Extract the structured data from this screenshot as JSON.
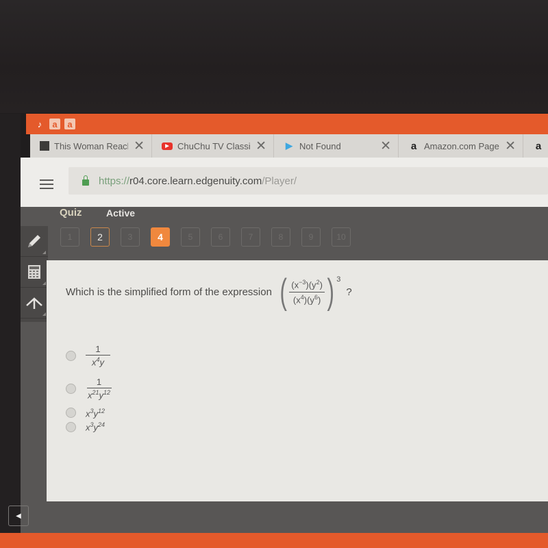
{
  "bookmarks": [
    {
      "icon": "tiktok-icon",
      "glyph": "♪"
    },
    {
      "icon": "amazon-icon",
      "glyph": "a"
    },
    {
      "icon": "amazon-icon",
      "glyph": "a"
    }
  ],
  "tabs": [
    {
      "title": "This Woman Reach",
      "favicon": "portrait-icon",
      "close": "✕"
    },
    {
      "title": "ChuChu TV Classic",
      "favicon": "youtube-icon",
      "close": "✕"
    },
    {
      "title": "Not Found",
      "favicon": "play-store-icon",
      "close": "✕"
    },
    {
      "title": "Amazon.com Page",
      "favicon": "amazon-icon",
      "close": "✕"
    },
    {
      "title": "",
      "favicon": "amazon-icon",
      "close": ""
    }
  ],
  "address": {
    "scheme": "https://",
    "host": "r04.core.learn.edgenuity.com",
    "path": "/Player/"
  },
  "quiz": {
    "title": "Quiz",
    "status": "Active",
    "questions": [
      "1",
      "2",
      "3",
      "4",
      "5",
      "6",
      "7",
      "8",
      "9",
      "10"
    ],
    "current": 4,
    "visited": [
      2
    ],
    "accent": "#f0883e"
  },
  "tools": [
    "pencil-icon",
    "calculator-icon",
    "pointer-icon"
  ],
  "question": {
    "prompt": "Which is the simplified form of the expression",
    "numerator_a": "(x",
    "numerator_a_exp": "−3",
    "numerator_b": ")(y",
    "numerator_b_exp": "2",
    "numerator_end": ")",
    "denominator_a": "(x",
    "denominator_a_exp": "4",
    "denominator_b": ")(y",
    "denominator_b_exp": "6",
    "denominator_end": ")",
    "outer_exponent": "3",
    "suffix": "?"
  },
  "options": [
    {
      "type": "fraction",
      "num": "1",
      "den_base1": "x",
      "den_exp1": "4",
      "den_base2": "y",
      "den_exp2": ""
    },
    {
      "type": "fraction",
      "num": "1",
      "den_base1": "x",
      "den_exp1": "21",
      "den_base2": "y",
      "den_exp2": "12"
    },
    {
      "type": "monomial",
      "base1": "x",
      "exp1": "3",
      "base2": "y",
      "exp2": "12"
    },
    {
      "type": "monomial",
      "base1": "x",
      "exp1": "3",
      "base2": "y",
      "exp2": "24"
    }
  ],
  "nav": {
    "back_glyph": "◀"
  }
}
